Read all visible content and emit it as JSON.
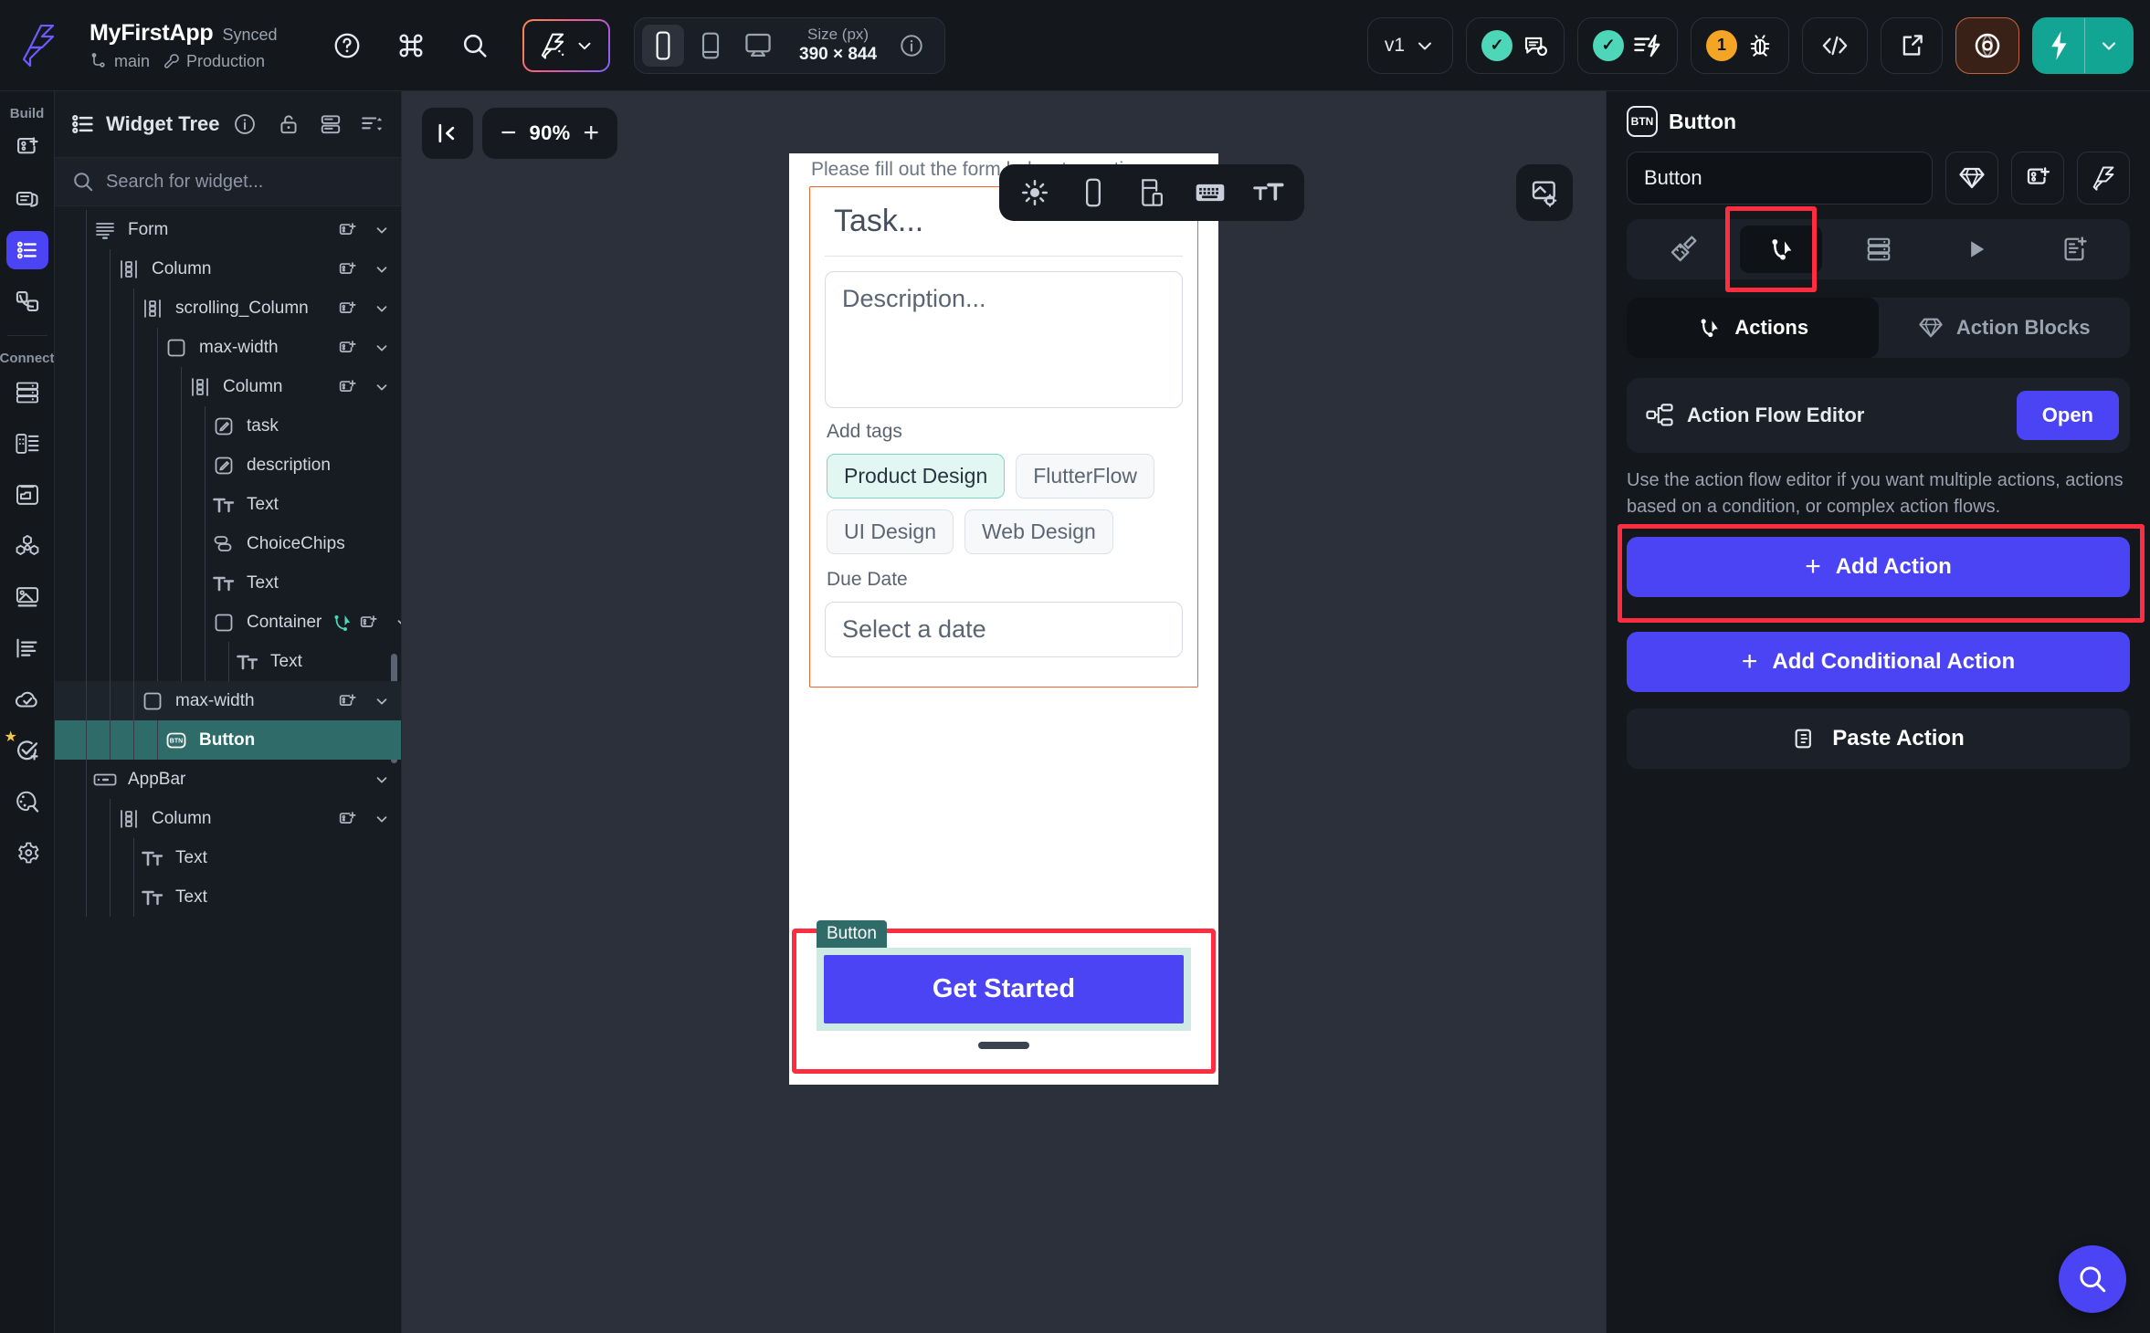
{
  "topbar": {
    "logo_icon": "flutterflow-logo-icon",
    "app_name": "MyFirstApp",
    "sync_status": "Synced",
    "branch_icon": "branch-icon",
    "branch": "main",
    "env_icon": "wrench-icon",
    "environment": "Production",
    "help_icon": "help-circle-icon",
    "command_icon": "command-key-icon",
    "search_icon": "search-icon",
    "magic_icon": "ai-magic-wand-icon",
    "magic_chevron_icon": "chevron-down-icon",
    "device_phone_icon": "phone-portrait-icon",
    "device_tablet_icon": "tablet-icon",
    "device_desktop_icon": "desktop-icon",
    "size_label": "Size (px)",
    "size_value": "390 × 844",
    "size_info_icon": "info-circle-icon",
    "version_label": "v1",
    "version_chevron_icon": "chevron-down-icon",
    "comments_icon": "comment-check-icon",
    "comments_badge": "✓",
    "issues_icon": "lightning-list-icon",
    "issues_badge": "✓",
    "debug_icon": "bug-icon",
    "debug_badge": "1",
    "code_icon": "code-brackets-icon",
    "share_icon": "external-link-icon",
    "preview_icon": "eye-target-icon",
    "run_icon": "lightning-bolt-icon",
    "run_chevron_icon": "chevron-down-icon"
  },
  "rail": {
    "build_label": "Build",
    "connect_label": "Connect",
    "items": [
      {
        "name": "new-page-icon"
      },
      {
        "name": "components-icon"
      },
      {
        "name": "widget-tree-icon"
      },
      {
        "name": "app-state-icon"
      },
      {
        "name": "database-icon"
      },
      {
        "name": "api-icon"
      },
      {
        "name": "media-folder-icon"
      },
      {
        "name": "integrations-icon"
      },
      {
        "name": "assets-image-icon"
      },
      {
        "name": "localization-icon"
      },
      {
        "name": "deploy-cloud-icon"
      },
      {
        "name": "tests-add-icon"
      },
      {
        "name": "theme-palette-icon"
      },
      {
        "name": "settings-gear-icon"
      }
    ]
  },
  "widget_tree": {
    "title": "Widget Tree",
    "info_icon": "info-circle-icon",
    "lock_icon": "unlock-icon",
    "layers_icon": "stacked-panels-icon",
    "sort_icon": "sort-expand-icon",
    "search_icon": "search-icon",
    "search_placeholder": "Search for widget...",
    "nodes": [
      {
        "label": "Form",
        "icon": "form-icon",
        "depth": 1,
        "add": true,
        "chevron": true,
        "state": "normal"
      },
      {
        "label": "Column",
        "icon": "column-icon",
        "depth": 2,
        "add": true,
        "chevron": true,
        "state": "normal"
      },
      {
        "label": "scrolling_Column",
        "icon": "column-icon",
        "depth": 3,
        "add": true,
        "chevron": true,
        "state": "normal"
      },
      {
        "label": "max-width",
        "icon": "container-icon",
        "depth": 4,
        "add": true,
        "chevron": true,
        "state": "normal"
      },
      {
        "label": "Column",
        "icon": "column-icon",
        "depth": 5,
        "add": true,
        "chevron": true,
        "state": "normal"
      },
      {
        "label": "task",
        "icon": "textfield-icon",
        "depth": 6,
        "add": false,
        "chevron": false,
        "state": "normal"
      },
      {
        "label": "description",
        "icon": "textfield-icon",
        "depth": 6,
        "add": false,
        "chevron": false,
        "state": "normal"
      },
      {
        "label": "Text",
        "icon": "text-icon",
        "depth": 6,
        "add": false,
        "chevron": false,
        "state": "normal"
      },
      {
        "label": "ChoiceChips",
        "icon": "choicechips-icon",
        "depth": 6,
        "add": false,
        "chevron": false,
        "state": "normal"
      },
      {
        "label": "Text",
        "icon": "text-icon",
        "depth": 6,
        "add": false,
        "chevron": false,
        "state": "normal"
      },
      {
        "label": "Container",
        "icon": "container-icon",
        "depth": 6,
        "add": true,
        "chevron": true,
        "state": "normal",
        "action_icon": "action-flow-icon"
      },
      {
        "label": "Text",
        "icon": "text-icon",
        "depth": 7,
        "add": false,
        "chevron": false,
        "state": "normal"
      },
      {
        "label": "max-width",
        "icon": "container-icon",
        "depth": 3,
        "add": true,
        "chevron": true,
        "state": "hl"
      },
      {
        "label": "Button",
        "icon": "button-icon",
        "depth": 4,
        "add": false,
        "chevron": false,
        "state": "selected"
      },
      {
        "label": "AppBar",
        "icon": "appbar-icon",
        "depth": 1,
        "add": false,
        "chevron": true,
        "state": "normal"
      },
      {
        "label": "Column",
        "icon": "column-icon",
        "depth": 2,
        "add": true,
        "chevron": true,
        "state": "normal"
      },
      {
        "label": "Text",
        "icon": "text-icon",
        "depth": 3,
        "add": false,
        "chevron": false,
        "state": "normal"
      },
      {
        "label": "Text",
        "icon": "text-icon",
        "depth": 3,
        "add": false,
        "chevron": false,
        "state": "normal"
      }
    ]
  },
  "canvas": {
    "collapse_icon": "collapse-left-icon",
    "zoom_minus": "−",
    "zoom_value": "90%",
    "zoom_plus": "+",
    "device_toolbar": [
      {
        "name": "brightness-sun-icon"
      },
      {
        "name": "device-frame-icon"
      },
      {
        "name": "split-view-icon"
      },
      {
        "name": "keyboard-icon"
      },
      {
        "name": "text-size-icon"
      }
    ],
    "settings_icon": "canvas-settings-icon",
    "preview": {
      "subtitle": "Please fill out the form below to continue",
      "task_placeholder": "Task...",
      "description_placeholder": "Description...",
      "tags_label": "Add tags",
      "chips": [
        {
          "label": "Product Design",
          "selected": true
        },
        {
          "label": "FlutterFlow",
          "selected": false
        },
        {
          "label": "UI Design",
          "selected": false
        },
        {
          "label": "Web Design",
          "selected": false
        }
      ],
      "due_date_label": "Due Date",
      "date_placeholder": "Select a date",
      "button_tag": "Button",
      "button_label": "Get Started"
    }
  },
  "properties": {
    "widget_icon": "button-icon",
    "widget_type": "Button",
    "name_value": "Button",
    "theme_icon": "diamond-theme-icon",
    "component_icon": "create-component-icon",
    "magic_icon": "ai-magic-wand-icon",
    "segments": [
      {
        "name": "properties-ruler-icon",
        "active": false
      },
      {
        "name": "actions-flow-icon",
        "active": true
      },
      {
        "name": "backend-query-icon",
        "active": false
      },
      {
        "name": "animations-play-icon",
        "active": false
      },
      {
        "name": "generate-doc-icon",
        "active": false
      }
    ],
    "tabs": [
      {
        "label": "Actions",
        "icon": "actions-flow-icon",
        "active": true
      },
      {
        "label": "Action Blocks",
        "icon": "diamond-theme-icon",
        "active": false
      }
    ],
    "action_flow_editor": {
      "icon": "flow-nodes-icon",
      "label": "Action Flow Editor",
      "open_label": "Open"
    },
    "helper_text": "Use the action flow editor if you want multiple actions, actions based on a condition, or complex action flows.",
    "add_action_label": "Add Action",
    "add_conditional_action_label": "Add Conditional Action",
    "paste_action_label": "Paste Action",
    "paste_icon": "paste-icon",
    "fab_icon": "help-search-icon"
  },
  "colors": {
    "accent_purple": "#4b44f5",
    "teal": "#12a594",
    "selected_row": "#2f6b68",
    "highlight_red": "#ff2d3f",
    "orange_outline": "#f2622a",
    "warning_orange": "#f5a524"
  }
}
